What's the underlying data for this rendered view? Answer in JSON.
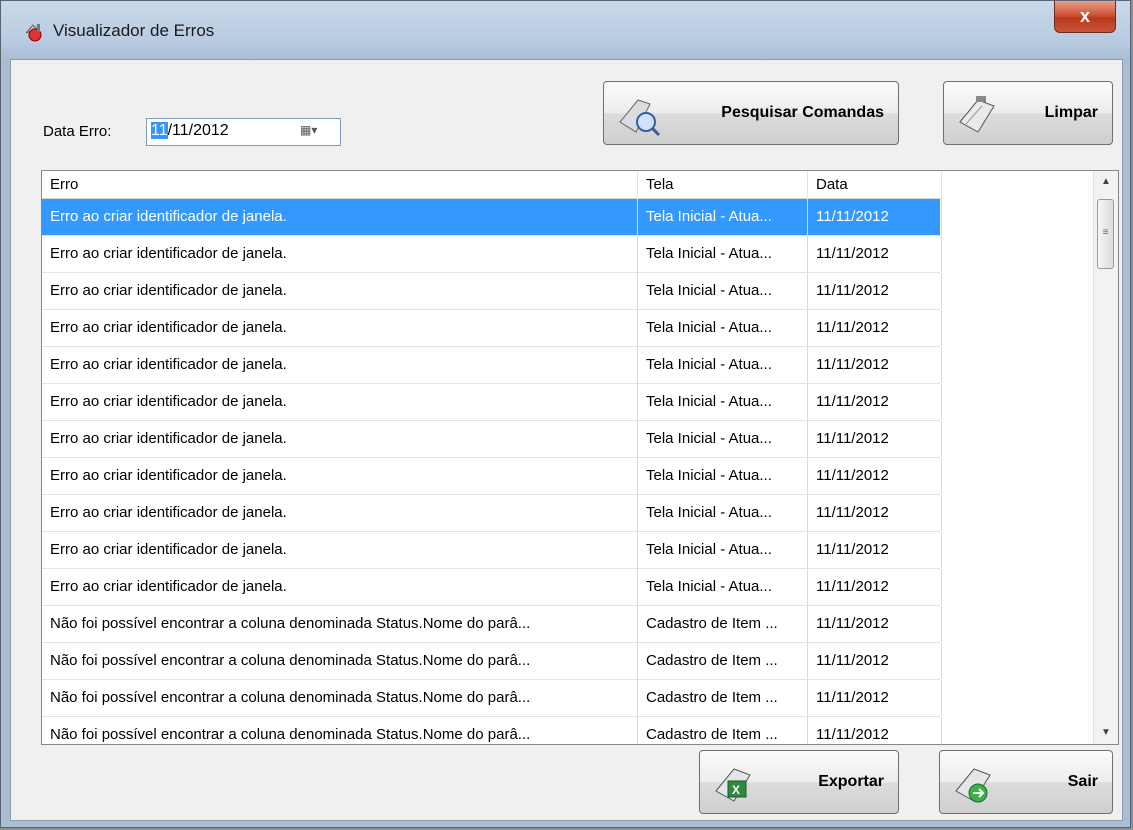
{
  "window": {
    "title": "Visualizador de Erros",
    "close_label": "x"
  },
  "filter": {
    "date_label": "Data Erro:",
    "date_value_selected": "11",
    "date_value_rest": "/11/2012",
    "calendar_glyph": "▦▾"
  },
  "toolbar": {
    "search_label": "Pesquisar Comandas",
    "clear_label": "Limpar",
    "export_label": "Exportar",
    "exit_label": "Sair"
  },
  "grid": {
    "columns": [
      "Erro",
      "Tela",
      "Data"
    ],
    "rows": [
      {
        "erro": "Erro ao criar identificador de janela.",
        "tela": "Tela Inicial - Atua...",
        "data": "11/11/2012"
      },
      {
        "erro": "Erro ao criar identificador de janela.",
        "tela": "Tela Inicial - Atua...",
        "data": "11/11/2012"
      },
      {
        "erro": "Erro ao criar identificador de janela.",
        "tela": "Tela Inicial - Atua...",
        "data": "11/11/2012"
      },
      {
        "erro": "Erro ao criar identificador de janela.",
        "tela": "Tela Inicial - Atua...",
        "data": "11/11/2012"
      },
      {
        "erro": "Erro ao criar identificador de janela.",
        "tela": "Tela Inicial - Atua...",
        "data": "11/11/2012"
      },
      {
        "erro": "Erro ao criar identificador de janela.",
        "tela": "Tela Inicial - Atua...",
        "data": "11/11/2012"
      },
      {
        "erro": "Erro ao criar identificador de janela.",
        "tela": "Tela Inicial - Atua...",
        "data": "11/11/2012"
      },
      {
        "erro": "Erro ao criar identificador de janela.",
        "tela": "Tela Inicial - Atua...",
        "data": "11/11/2012"
      },
      {
        "erro": "Erro ao criar identificador de janela.",
        "tela": "Tela Inicial - Atua...",
        "data": "11/11/2012"
      },
      {
        "erro": "Erro ao criar identificador de janela.",
        "tela": "Tela Inicial - Atua...",
        "data": "11/11/2012"
      },
      {
        "erro": "Erro ao criar identificador de janela.",
        "tela": "Tela Inicial - Atua...",
        "data": "11/11/2012"
      },
      {
        "erro": "Não foi possível encontrar a coluna denominada Status.Nome do parâ...",
        "tela": "Cadastro de Item ...",
        "data": "11/11/2012"
      },
      {
        "erro": "Não foi possível encontrar a coluna denominada Status.Nome do parâ...",
        "tela": "Cadastro de Item ...",
        "data": "11/11/2012"
      },
      {
        "erro": "Não foi possível encontrar a coluna denominada Status.Nome do parâ...",
        "tela": "Cadastro de Item ...",
        "data": "11/11/2012"
      },
      {
        "erro": "Não foi possível encontrar a coluna denominada Status.Nome do parâ...",
        "tela": "Cadastro de Item ...",
        "data": "11/11/2012"
      }
    ],
    "selected_row": 0
  },
  "scrollbar": {
    "up_glyph": "▲",
    "down_glyph": "▼",
    "thumb_glyph": "≡"
  },
  "colors": {
    "selection": "#3399ff",
    "close_button": "#c9553a"
  }
}
